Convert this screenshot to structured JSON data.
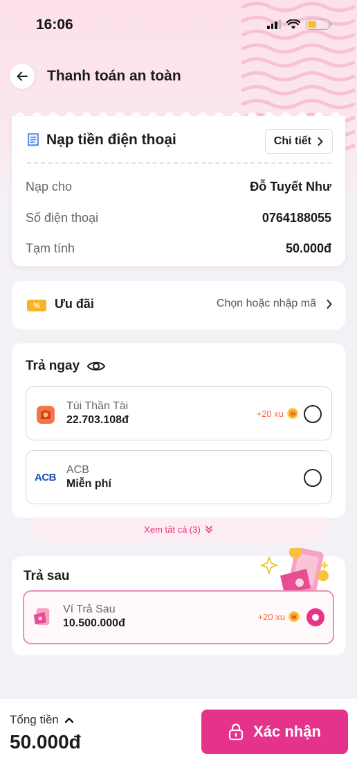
{
  "status_bar": {
    "time": "16:06"
  },
  "header": {
    "title": "Thanh toán an toàn"
  },
  "order": {
    "title": "Nạp tiền điện thoại",
    "detail_label": "Chi tiết",
    "rows": [
      {
        "label": "Nạp cho",
        "value": "Đỗ Tuyết Như"
      },
      {
        "label": "Số điện thoại",
        "value": "0764188055"
      },
      {
        "label": "Tạm tính",
        "value": "50.000đ"
      }
    ]
  },
  "promo": {
    "label": "Ưu đãi",
    "action": "Chọn hoặc nhập mã",
    "icon_text": "%"
  },
  "pay_now": {
    "title": "Trả ngay",
    "methods": [
      {
        "name": "Túi Thần Tài",
        "sub": "22.703.108đ",
        "reward": "+20 xu",
        "selected": false
      },
      {
        "name": "ACB",
        "sub": "Miễn phí",
        "logo": "ACB",
        "selected": false
      }
    ],
    "see_all": "Xem tất cả (3)"
  },
  "pay_later": {
    "title": "Trả sau",
    "methods": [
      {
        "name": "Ví Trả Sau",
        "sub": "10.500.000đ",
        "reward": "+20 xu",
        "selected": true
      }
    ]
  },
  "footer": {
    "total_label": "Tổng tiền",
    "total_value": "50.000đ",
    "confirm_label": "Xác nhận"
  },
  "colors": {
    "accent": "#e5338b",
    "reward": "#f36a3d",
    "promo": "#f7b32b"
  }
}
